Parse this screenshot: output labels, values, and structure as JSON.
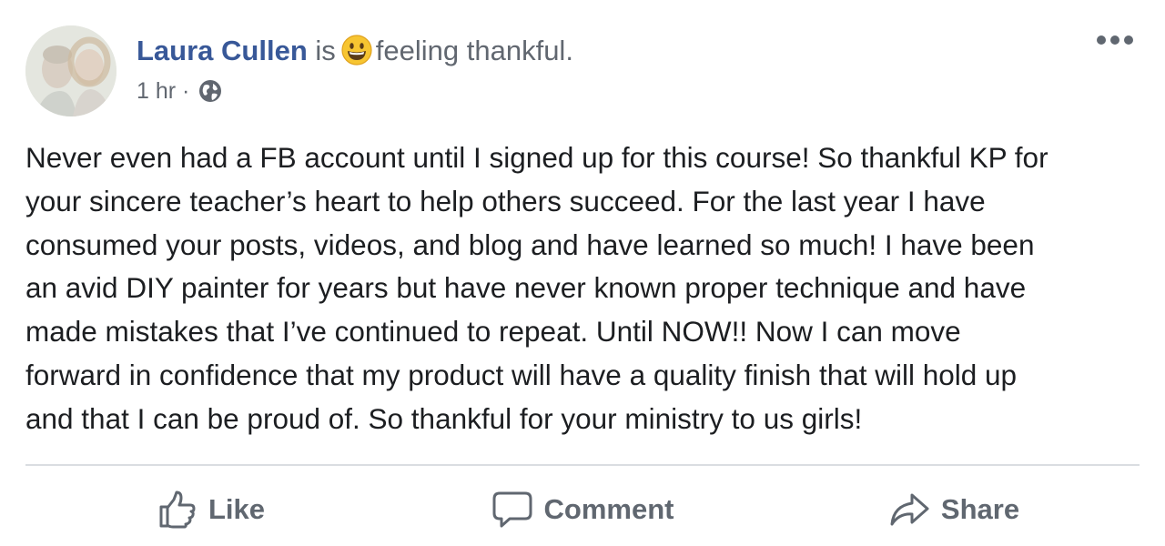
{
  "post": {
    "author": "Laura Cullen",
    "status_prefix": "is",
    "status_emoji": "grinning-face-emoji",
    "feeling": "feeling thankful.",
    "time": "1 hr",
    "separator": "·",
    "privacy_icon": "globe-icon",
    "more_icon": "more-options-icon",
    "body_lines": [
      "Never even had a FB account until I signed up for this course! So thankful KP for",
      "your sincere teacher’s heart to help others succeed. For the last year I have",
      "consumed your posts, videos, and blog and have learned so much! I have been",
      "an avid DIY painter for years but have never known proper technique and have",
      "made mistakes that I’ve continued to repeat. Until NOW!! Now I can move",
      "forward in confidence that my product will have a quality finish that will hold up",
      "and that I can be proud of. So thankful for your ministry to us girls!"
    ]
  },
  "actions": {
    "like": {
      "label": "Like",
      "icon": "thumbs-up-icon"
    },
    "comment": {
      "label": "Comment",
      "icon": "comment-bubble-icon"
    },
    "share": {
      "label": "Share",
      "icon": "share-arrow-icon"
    }
  },
  "colors": {
    "author_link": "#385898",
    "secondary_text": "#616770",
    "body_text": "#1c1e21",
    "action_text": "#606770",
    "divider": "#dadde1"
  }
}
